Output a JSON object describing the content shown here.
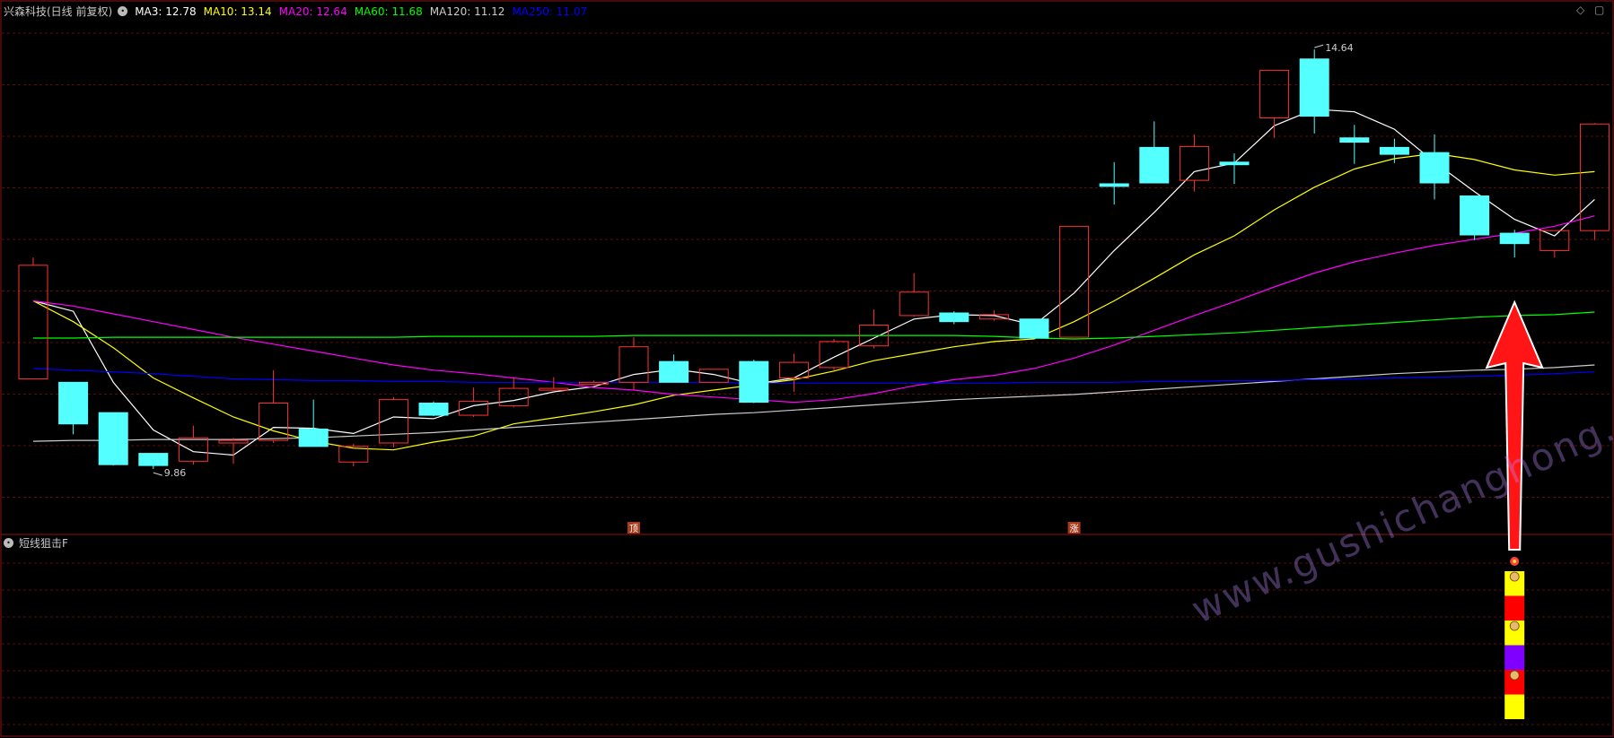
{
  "header": {
    "stock_title": "兴森科技(日线 前复权)",
    "indicators": [
      {
        "label": "MA3: 12.78",
        "color": "#ffffff"
      },
      {
        "label": "MA10: 13.14",
        "color": "#ffff00"
      },
      {
        "label": "MA20: 12.64",
        "color": "#ff00ff"
      },
      {
        "label": "MA60: 11.68",
        "color": "#00ff00"
      },
      {
        "label": "MA120: 11.12",
        "color": "#cccccc"
      },
      {
        "label": "MA250: 11.07",
        "color": "#0000ff"
      }
    ]
  },
  "sub_panel": {
    "title": "短线狙击F"
  },
  "top_right_icons": [
    "diamond-icon",
    "window-icon"
  ],
  "watermark": "www.gushichanghong.com",
  "chart_data": {
    "type": "candlestick",
    "ylim": [
      9.5,
      14.9
    ],
    "candles": [
      {
        "o": 10.84,
        "c": 12.15,
        "h": 12.24,
        "l": 10.84
      },
      {
        "o": 10.8,
        "c": 10.32,
        "h": 10.8,
        "l": 10.2
      },
      {
        "o": 10.45,
        "c": 9.85,
        "h": 10.45,
        "l": 9.84
      },
      {
        "o": 9.98,
        "c": 9.84,
        "h": 9.98,
        "l": 9.8
      },
      {
        "o": 9.89,
        "c": 10.16,
        "h": 10.3,
        "l": 9.85
      },
      {
        "o": 10.1,
        "c": 10.13,
        "h": 10.16,
        "l": 9.86
      },
      {
        "o": 10.13,
        "c": 10.56,
        "h": 10.94,
        "l": 10.1
      },
      {
        "o": 10.26,
        "c": 10.06,
        "h": 10.6,
        "l": 10.06
      },
      {
        "o": 9.88,
        "c": 10.06,
        "h": 10.09,
        "l": 9.83
      },
      {
        "o": 10.1,
        "c": 10.6,
        "h": 10.63,
        "l": 10.05
      },
      {
        "o": 10.56,
        "c": 10.42,
        "h": 10.58,
        "l": 10.41
      },
      {
        "o": 10.42,
        "c": 10.58,
        "h": 10.74,
        "l": 10.4
      },
      {
        "o": 10.53,
        "c": 10.73,
        "h": 10.86,
        "l": 10.51
      },
      {
        "o": 10.73,
        "c": 10.73,
        "h": 10.86,
        "l": 10.73
      },
      {
        "o": 10.78,
        "c": 10.8,
        "h": 10.82,
        "l": 10.77
      },
      {
        "o": 10.8,
        "c": 11.21,
        "h": 11.32,
        "l": 10.71
      },
      {
        "o": 11.04,
        "c": 10.8,
        "h": 11.12,
        "l": 10.8
      },
      {
        "o": 10.8,
        "c": 10.95,
        "h": 10.95,
        "l": 10.8
      },
      {
        "o": 11.04,
        "c": 10.57,
        "h": 11.06,
        "l": 10.56
      },
      {
        "o": 10.85,
        "c": 11.03,
        "h": 11.13,
        "l": 10.69
      },
      {
        "o": 10.97,
        "c": 11.27,
        "h": 11.3,
        "l": 10.94
      },
      {
        "o": 11.22,
        "c": 11.46,
        "h": 11.64,
        "l": 11.19
      },
      {
        "o": 11.57,
        "c": 11.84,
        "h": 12.06,
        "l": 11.56
      },
      {
        "o": 11.6,
        "c": 11.5,
        "h": 11.62,
        "l": 11.47
      },
      {
        "o": 11.53,
        "c": 11.58,
        "h": 11.63,
        "l": 11.51
      },
      {
        "o": 11.53,
        "c": 11.31,
        "h": 11.53,
        "l": 11.31
      },
      {
        "o": 11.32,
        "c": 12.6,
        "h": 12.6,
        "l": 11.32
      },
      {
        "o": 13.09,
        "c": 13.06,
        "h": 13.34,
        "l": 12.85
      },
      {
        "o": 13.51,
        "c": 13.1,
        "h": 13.81,
        "l": 13.1
      },
      {
        "o": 13.13,
        "c": 13.52,
        "h": 13.66,
        "l": 13.0
      },
      {
        "o": 13.34,
        "c": 13.31,
        "h": 13.44,
        "l": 13.09
      },
      {
        "o": 13.85,
        "c": 14.4,
        "h": 14.4,
        "l": 13.62
      },
      {
        "o": 14.53,
        "c": 13.87,
        "h": 14.64,
        "l": 13.67
      },
      {
        "o": 13.62,
        "c": 13.57,
        "h": 13.77,
        "l": 13.32
      },
      {
        "o": 13.51,
        "c": 13.43,
        "h": 13.61,
        "l": 13.33
      },
      {
        "o": 13.45,
        "c": 13.1,
        "h": 13.66,
        "l": 12.91
      },
      {
        "o": 12.95,
        "c": 12.5,
        "h": 12.95,
        "l": 12.44
      },
      {
        "o": 12.52,
        "c": 12.4,
        "h": 12.56,
        "l": 12.24
      },
      {
        "o": 12.32,
        "c": 12.55,
        "h": 12.55,
        "l": 12.24
      },
      {
        "o": 12.55,
        "c": 13.78,
        "h": 13.79,
        "l": 12.44
      }
    ],
    "ma_lines": [
      {
        "name": "MA3",
        "color": "#ffffff",
        "values": [
          11.74,
          11.62,
          10.8,
          10.25,
          10.0,
          9.96,
          10.28,
          10.27,
          10.21,
          10.4,
          10.38,
          10.53,
          10.59,
          10.69,
          10.75,
          10.89,
          10.95,
          10.89,
          10.78,
          10.85,
          11.09,
          11.31,
          11.53,
          11.58,
          11.57,
          11.46,
          11.83,
          12.32,
          12.76,
          13.23,
          13.33,
          13.76,
          13.95,
          13.92,
          13.72,
          13.34,
          13.0,
          12.68,
          12.49,
          12.91
        ]
      },
      {
        "name": "MA10",
        "color": "#ffff00",
        "values": [
          11.74,
          11.5,
          11.2,
          10.85,
          10.62,
          10.4,
          10.24,
          10.12,
          10.04,
          10.02,
          10.11,
          10.18,
          10.32,
          10.39,
          10.46,
          10.54,
          10.65,
          10.71,
          10.77,
          10.83,
          10.93,
          11.05,
          11.13,
          11.21,
          11.27,
          11.3,
          11.5,
          11.74,
          12.0,
          12.27,
          12.49,
          12.79,
          13.05,
          13.26,
          13.38,
          13.44,
          13.37,
          13.25,
          13.19,
          13.23
        ]
      },
      {
        "name": "MA20",
        "color": "#ff00ff",
        "values": [
          11.74,
          11.68,
          11.59,
          11.5,
          11.41,
          11.32,
          11.24,
          11.16,
          11.08,
          11.0,
          10.94,
          10.9,
          10.85,
          10.8,
          10.74,
          10.71,
          10.66,
          10.63,
          10.6,
          10.57,
          10.6,
          10.67,
          10.76,
          10.83,
          10.88,
          10.96,
          11.08,
          11.23,
          11.4,
          11.57,
          11.73,
          11.9,
          12.06,
          12.19,
          12.29,
          12.38,
          12.45,
          12.52,
          12.6,
          12.72
        ]
      },
      {
        "name": "MA60",
        "color": "#00ff00",
        "values": [
          11.31,
          11.31,
          11.32,
          11.32,
          11.32,
          11.32,
          11.32,
          11.32,
          11.32,
          11.32,
          11.33,
          11.33,
          11.33,
          11.33,
          11.33,
          11.34,
          11.34,
          11.34,
          11.34,
          11.34,
          11.34,
          11.34,
          11.34,
          11.34,
          11.33,
          11.31,
          11.3,
          11.31,
          11.33,
          11.35,
          11.37,
          11.4,
          11.43,
          11.46,
          11.49,
          11.52,
          11.55,
          11.57,
          11.58,
          11.61
        ]
      },
      {
        "name": "MA120",
        "color": "#cccccc",
        "values": [
          10.12,
          10.13,
          10.13,
          10.14,
          10.14,
          10.14,
          10.15,
          10.16,
          10.18,
          10.2,
          10.22,
          10.25,
          10.28,
          10.31,
          10.34,
          10.37,
          10.4,
          10.43,
          10.45,
          10.48,
          10.51,
          10.54,
          10.57,
          10.6,
          10.62,
          10.64,
          10.66,
          10.69,
          10.72,
          10.75,
          10.78,
          10.81,
          10.84,
          10.87,
          10.9,
          10.92,
          10.94,
          10.95,
          10.97,
          11.0
        ]
      },
      {
        "name": "MA250",
        "color": "#0000ff",
        "values": [
          10.96,
          10.94,
          10.92,
          10.9,
          10.87,
          10.84,
          10.83,
          10.82,
          10.82,
          10.81,
          10.81,
          10.8,
          10.8,
          10.8,
          10.8,
          10.8,
          10.8,
          10.8,
          10.79,
          10.79,
          10.79,
          10.79,
          10.79,
          10.79,
          10.79,
          10.8,
          10.8,
          10.8,
          10.81,
          10.81,
          10.82,
          10.82,
          10.83,
          10.84,
          10.85,
          10.86,
          10.87,
          10.88,
          10.9,
          10.92
        ]
      }
    ],
    "price_labels": [
      {
        "text": "14.64",
        "index": 32,
        "value": 14.64,
        "type": "high"
      },
      {
        "text": "9.86",
        "index": 3,
        "value": 9.84,
        "type": "low"
      }
    ],
    "signal_markers": [
      {
        "text": "顶",
        "index": 15
      },
      {
        "text": "涨",
        "index": 26
      }
    ],
    "sub_indicator": {
      "index": 37,
      "blocks": [
        "#ffff00",
        "#ff0000",
        "#ffff00",
        "#8000ff",
        "#ff0000",
        "#ffff00"
      ],
      "top_icon": "flower-icon",
      "item_icon": "money-bag-icon"
    },
    "annotation": {
      "type": "up-arrow",
      "index": 37,
      "color": "#ff0000"
    }
  }
}
